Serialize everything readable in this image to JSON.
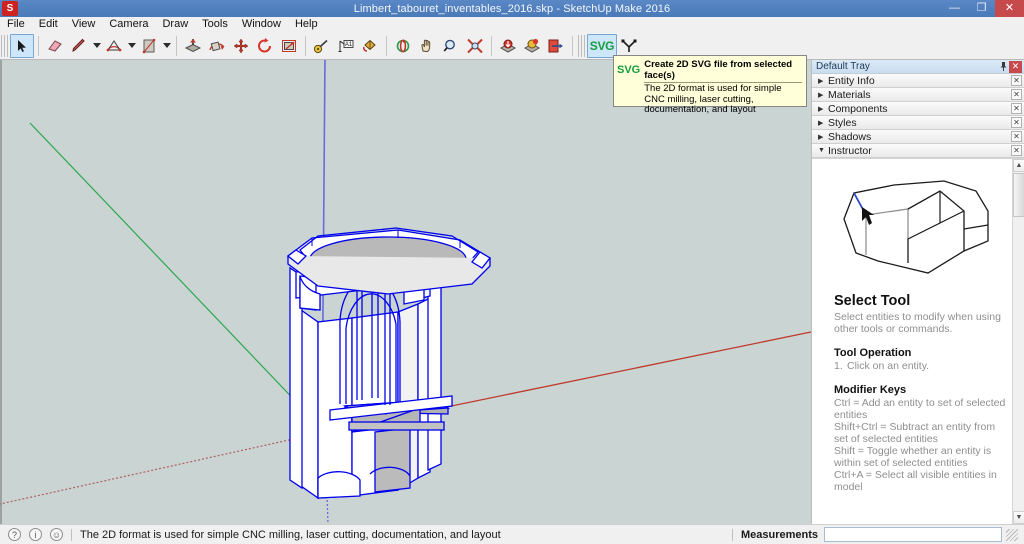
{
  "window": {
    "title": "Limbert_tabouret_inventables_2016.skp - SketchUp Make 2016",
    "logo_glyph": "S",
    "minimize_label": "—",
    "maximize_label": "❐",
    "close_label": "✕"
  },
  "menubar": {
    "items": [
      {
        "label": "File"
      },
      {
        "label": "Edit"
      },
      {
        "label": "View"
      },
      {
        "label": "Camera"
      },
      {
        "label": "Draw"
      },
      {
        "label": "Tools"
      },
      {
        "label": "Window"
      },
      {
        "label": "Help"
      }
    ]
  },
  "toolbar": {
    "tools": [
      {
        "name": "select-tool",
        "icon": "arrow-cursor-icon",
        "active": true
      },
      {
        "name": "eraser-tool",
        "icon": "eraser-icon",
        "active": false
      },
      {
        "name": "line-tool",
        "icon": "pencil-icon",
        "active": false
      },
      {
        "name": "arc-tool",
        "icon": "arc-icon",
        "active": false
      },
      {
        "name": "rectangle-tool",
        "icon": "rectangle-icon",
        "active": false
      },
      {
        "name": "pushpull-tool",
        "icon": "pushpull-icon",
        "active": false
      },
      {
        "name": "followme-tool",
        "icon": "followme-icon",
        "active": false
      },
      {
        "name": "move-tool",
        "icon": "move-arrows-icon",
        "active": false
      },
      {
        "name": "rotate-tool",
        "icon": "rotate-icon",
        "active": false
      },
      {
        "name": "offset-tool",
        "icon": "offset-icon",
        "active": false
      },
      {
        "name": "tape-measure-tool",
        "icon": "tape-measure-icon",
        "active": false
      },
      {
        "name": "text-tool",
        "icon": "text-label-icon",
        "active": false
      },
      {
        "name": "paint-bucket-tool",
        "icon": "paint-bucket-icon",
        "active": false
      },
      {
        "name": "orbit-tool",
        "icon": "orbit-icon",
        "active": false
      },
      {
        "name": "pan-tool",
        "icon": "hand-icon",
        "active": false
      },
      {
        "name": "zoom-tool",
        "icon": "magnifier-icon",
        "active": false
      },
      {
        "name": "zoom-extents-tool",
        "icon": "zoom-extents-icon",
        "active": false
      },
      {
        "name": "get-models-tool",
        "icon": "warehouse-download-icon",
        "active": false
      },
      {
        "name": "share-model-tool",
        "icon": "warehouse-upload-icon",
        "active": false
      },
      {
        "name": "layout-tool",
        "icon": "send-to-layout-icon",
        "active": false
      }
    ],
    "svg_button_label": "SVG",
    "vector_button_icon": "vector-nodes-icon"
  },
  "tooltip": {
    "icon_label": "SVG",
    "title": "Create 2D SVG file from selected face(s)",
    "description": "The 2D format is used for simple CNC milling, laser cutting, documentation, and layout"
  },
  "canvas": {
    "background_color": "#c9d4d3",
    "axis_red_color": "#c0392b",
    "axis_green_color": "#2ea84f",
    "axis_blue_color": "#5b5bd6",
    "selection_color": "#0000ee",
    "model_fill_color": "#ffffff",
    "model_shade_color": "#b7b7b7",
    "model_description": "Limbert tabouret stool, all edges selected"
  },
  "tray": {
    "title": "Default Tray",
    "pin_icon": "pin-icon",
    "close_icon": "close-icon",
    "panels": [
      {
        "label": "Entity Info",
        "expanded": false
      },
      {
        "label": "Materials",
        "expanded": false
      },
      {
        "label": "Components",
        "expanded": false
      },
      {
        "label": "Styles",
        "expanded": false
      },
      {
        "label": "Shadows",
        "expanded": false
      },
      {
        "label": "Instructor",
        "expanded": true
      }
    ],
    "collapsed_arrow": "▶",
    "expanded_arrow": "▼",
    "panel_close_label": "✕"
  },
  "instructor": {
    "figure_alt": "house-line-drawing-with-cursor",
    "heading": "Select Tool",
    "subtitle": "Select entities to modify when using other tools or commands.",
    "operation_heading": "Tool Operation",
    "operation_steps": [
      {
        "num": "1.",
        "text": "Click on an entity."
      }
    ],
    "modifier_heading": "Modifier Keys",
    "modifier_lines": [
      "Ctrl = Add an entity to set of selected entities",
      "Shift+Ctrl = Subtract an entity from set of selected entities",
      "Shift = Toggle whether an entity is within set of selected entities",
      "Ctrl+A = Select all visible entities in model"
    ]
  },
  "statusbar": {
    "icons": [
      {
        "name": "help-circle-icon",
        "glyph": "?"
      },
      {
        "name": "info-circle-icon",
        "glyph": "i"
      },
      {
        "name": "person-circle-icon",
        "glyph": "☺"
      }
    ],
    "message": "The 2D format is used for simple CNC milling, laser cutting, documentation, and layout",
    "measurements_label": "Measurements",
    "measurements_value": "",
    "measurements_placeholder": ""
  }
}
